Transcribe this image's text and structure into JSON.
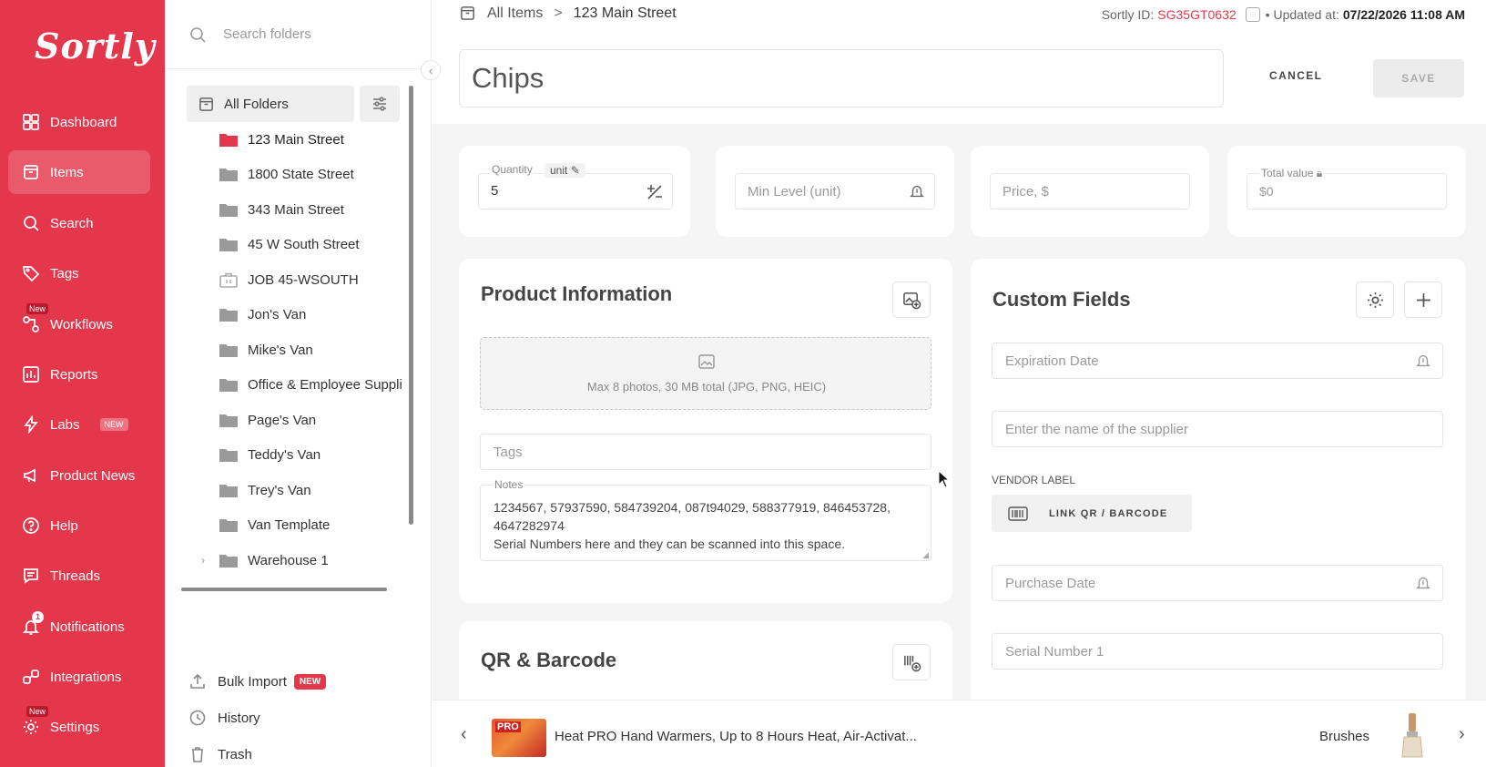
{
  "app": {
    "logo": "Sortly"
  },
  "nav": {
    "items": [
      {
        "label": "Dashboard",
        "icon": "dashboard-icon"
      },
      {
        "label": "Items",
        "icon": "items-icon",
        "active": true
      },
      {
        "label": "Search",
        "icon": "search-icon"
      },
      {
        "label": "Tags",
        "icon": "tag-icon"
      },
      {
        "label": "Workflows",
        "icon": "workflows-icon",
        "badge": "New"
      },
      {
        "label": "Reports",
        "icon": "reports-icon"
      },
      {
        "label": "Labs",
        "icon": "lightning-icon",
        "badge": "NEW"
      },
      {
        "label": "Product News",
        "icon": "megaphone-icon"
      },
      {
        "label": "Help",
        "icon": "help-icon"
      },
      {
        "label": "Threads",
        "icon": "chat-icon"
      },
      {
        "label": "Notifications",
        "icon": "bell-icon",
        "count": "1"
      },
      {
        "label": "Integrations",
        "icon": "integrations-icon"
      },
      {
        "label": "Settings",
        "icon": "gear-icon",
        "badge": "New"
      }
    ]
  },
  "folders": {
    "search_placeholder": "Search folders",
    "all_label": "All Folders",
    "tree": [
      {
        "label": "123 Main Street",
        "selected": true,
        "color": "#e5374b"
      },
      {
        "label": "1800 State Street"
      },
      {
        "label": "343 Main Street"
      },
      {
        "label": "45 W South Street"
      },
      {
        "label": "JOB 45-WSOUTH",
        "icon": "briefcase"
      },
      {
        "label": "Jon's Van"
      },
      {
        "label": "Mike's Van"
      },
      {
        "label": "Office & Employee Suppli"
      },
      {
        "label": "Page's Van"
      },
      {
        "label": "Teddy's Van"
      },
      {
        "label": "Trey's Van"
      },
      {
        "label": "Van Template"
      },
      {
        "label": "Warehouse 1",
        "expandable": true
      }
    ],
    "bulk_import": "Bulk Import",
    "bulk_badge": "NEW",
    "history": "History",
    "trash": "Trash"
  },
  "header": {
    "breadcrumb_root": "All Items",
    "breadcrumb_sep": ">",
    "breadcrumb_current": "123 Main Street",
    "sortly_id_label": "Sortly ID:",
    "sortly_id": "SG35GT0632",
    "updated_label": "• Updated at:",
    "updated_value": "07/22/2026 11:08 AM",
    "item_name": "Chips",
    "cancel": "CANCEL",
    "save": "SAVE"
  },
  "stats": {
    "quantity_label": "Quantity",
    "unit_label": "unit",
    "quantity_value": "5",
    "min_level_placeholder": "Min Level (unit)",
    "price_placeholder": "Price, $",
    "total_label": "Total value",
    "total_value": "$0"
  },
  "product": {
    "title": "Product Information",
    "photo_hint": "Max 8 photos, 30 MB total (JPG, PNG, HEIC)",
    "tags_placeholder": "Tags",
    "notes_label": "Notes",
    "notes_line1": "1234567, 57937590, 584739204, 087t94029, 588377919, 846453728,",
    "notes_line2": "4647282974",
    "notes_line3": "Serial Numbers here and they can be scanned into this space."
  },
  "qr": {
    "title": "QR & Barcode"
  },
  "custom": {
    "title": "Custom Fields",
    "expiration_placeholder": "Expiration Date",
    "supplier_placeholder": "Enter the name of the supplier",
    "vendor_label": "VENDOR LABEL",
    "link_qr": "LINK QR / BARCODE",
    "purchase_placeholder": "Purchase Date",
    "serial_placeholder": "Serial Number 1"
  },
  "bottom": {
    "prev_item": "Heat PRO Hand Warmers, Up to 8 Hours Heat, Air-Activat...",
    "thumb_text": "PRO",
    "next_item": "Brushes"
  },
  "colors": {
    "brand": "#e5374b",
    "background": "#f5f5f6"
  }
}
